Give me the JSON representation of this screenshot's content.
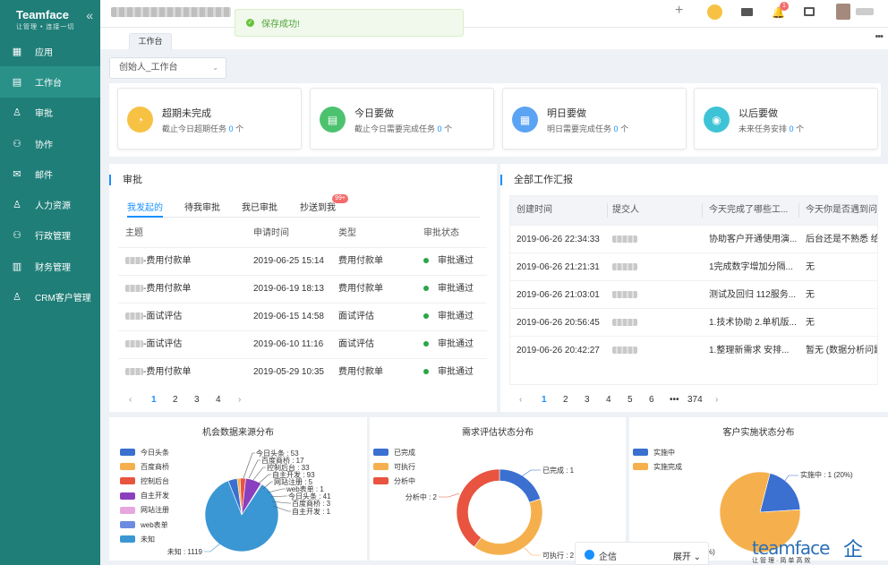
{
  "app": {
    "name": "Teamface",
    "slogan": "让管理 • 连接一切"
  },
  "sidebar": {
    "collapse_icon": "double-chevron-left-icon",
    "items": [
      {
        "label": "应用",
        "icon": "apps-grid-icon",
        "active": false
      },
      {
        "label": "工作台",
        "icon": "dashboard-icon",
        "active": true
      },
      {
        "label": "审批",
        "icon": "person-stamp-icon",
        "active": false
      },
      {
        "label": "协作",
        "icon": "team-icon",
        "active": false
      },
      {
        "label": "邮件",
        "icon": "envelope-icon",
        "active": false
      },
      {
        "label": "人力资源",
        "icon": "person-hr-icon",
        "active": false
      },
      {
        "label": "行政管理",
        "icon": "admin-people-icon",
        "active": false
      },
      {
        "label": "财务管理",
        "icon": "finance-icon",
        "active": false
      },
      {
        "label": "CRM客户管理",
        "icon": "crm-icon",
        "active": false
      }
    ]
  },
  "topbar": {
    "toast": "保存成功!",
    "notification_count": "1"
  },
  "tabs": [
    {
      "label": "工作台"
    }
  ],
  "workbench_selector": "创始人_工作台",
  "task_cards": [
    {
      "title": "超期未完成",
      "subtitle_prefix": "截止今日超期任务",
      "count": "0",
      "suffix": "个",
      "color": "#f7c244",
      "icon": "clock-warning-icon"
    },
    {
      "title": "今日要做",
      "subtitle_prefix": "截止今日需要完成任务",
      "count": "0",
      "suffix": "个",
      "color": "#4cc26f",
      "icon": "calendar-today-icon"
    },
    {
      "title": "明日要做",
      "subtitle_prefix": "明日需要完成任务",
      "count": "0",
      "suffix": "个",
      "color": "#5ba3f3",
      "icon": "calendar-icon"
    },
    {
      "title": "以后要做",
      "subtitle_prefix": "未来任务安排",
      "count": "0",
      "suffix": "个",
      "color": "#3ec3d6",
      "icon": "target-icon"
    }
  ],
  "approval": {
    "title": "审批",
    "tabs": [
      {
        "label": "我发起的",
        "active": true
      },
      {
        "label": "待我审批",
        "active": false
      },
      {
        "label": "我已审批",
        "active": false
      },
      {
        "label": "抄送到我",
        "active": false,
        "badge": "99+"
      }
    ],
    "columns": [
      "主题",
      "申请时间",
      "类型",
      "审批状态"
    ],
    "rows": [
      {
        "subject": "-费用付款单",
        "time": "2019-06-25 15:14",
        "type": "费用付款单",
        "status": "审批通过"
      },
      {
        "subject": "-费用付款单",
        "time": "2019-06-19 18:13",
        "type": "费用付款单",
        "status": "审批通过"
      },
      {
        "subject": "-面试评估",
        "time": "2019-06-15 14:58",
        "type": "面试评估",
        "status": "审批通过"
      },
      {
        "subject": "-面试评估",
        "time": "2019-06-10 11:16",
        "type": "面试评估",
        "status": "审批通过"
      },
      {
        "subject": "-费用付款单",
        "time": "2019-05-29 10:35",
        "type": "费用付款单",
        "status": "审批通过"
      }
    ],
    "pages": [
      "1",
      "2",
      "3",
      "4"
    ],
    "current_page": "1"
  },
  "reports": {
    "title": "全部工作汇报",
    "columns": [
      "创建时间",
      "提交人",
      "今天完成了哪些工...",
      "今天你是否遇到问..."
    ],
    "rows": [
      {
        "time": "2019-06-26 22:34:33",
        "done": "协助客户开通使用演...",
        "issue": "后台还是不熟悉 给..."
      },
      {
        "time": "2019-06-26 21:21:31",
        "done": "1完成数字增加分隔...",
        "issue": "无"
      },
      {
        "time": "2019-06-26 21:03:01",
        "done": "测试及回归 112服务...",
        "issue": "无"
      },
      {
        "time": "2019-06-26 20:56:45",
        "done": "1.技术协助 2.单机版...",
        "issue": "无"
      },
      {
        "time": "2019-06-26 20:42:27",
        "done": "1.整理新需求 安排...",
        "issue": "暂无 (数据分析问题"
      }
    ],
    "pages": [
      "1",
      "2",
      "3",
      "4",
      "5",
      "6",
      "•••",
      "374"
    ],
    "current_page": "1"
  },
  "charts_text": {
    "source_title": "机会数据来源分布",
    "demand_title": "需求评估状态分布",
    "customer_title": "客户实施状态分布"
  },
  "chart_data": [
    {
      "type": "pie",
      "title": "机会数据来源分布",
      "legend_position": "left",
      "series": [
        {
          "name": "今日头条",
          "value": 53,
          "color": "#3b6fd0"
        },
        {
          "name": "百度商桥",
          "value": 17,
          "color": "#f5b04d"
        },
        {
          "name": "控制后台",
          "value": 33,
          "color": "#e8543f"
        },
        {
          "name": "自主开发",
          "value": 93,
          "color": "#8a3fbf"
        },
        {
          "name": "网站注册",
          "value": 5,
          "color": "#e8a6df"
        },
        {
          "name": "web表单",
          "value": 1,
          "color": "#6c8be0"
        },
        {
          "name": "未知",
          "value": 1119,
          "color": "#3a97d4"
        }
      ],
      "labels": [
        "今日头条 : 53",
        "百度商桥 : 17",
        "控制后台 : 33",
        "自主开发 : 93",
        "网站注册 : 5",
        "web表单 : 1",
        "今日头条 : 41",
        "百度商桥 : 3",
        "自主开发 : 1",
        "未知 : 1119"
      ]
    },
    {
      "type": "pie",
      "variant": "donut",
      "title": "需求评估状态分布",
      "legend_position": "left",
      "series": [
        {
          "name": "已完成",
          "value": 1,
          "color": "#3b6fd0"
        },
        {
          "name": "可执行",
          "value": 2,
          "color": "#f5b04d"
        },
        {
          "name": "分析中",
          "value": 2,
          "color": "#e8543f"
        }
      ],
      "labels": [
        "已完成 : 1",
        "可执行 : 2",
        "分析中 : 2"
      ]
    },
    {
      "type": "pie",
      "title": "客户实施状态分布",
      "legend_position": "left",
      "series": [
        {
          "name": "实施中",
          "value": 1,
          "percent": 20,
          "color": "#3b6fd0"
        },
        {
          "name": "实施完成",
          "value": 4,
          "color": "#f5b04d"
        }
      ],
      "labels": [
        "实施中 : 1 (20%)",
        "%)"
      ]
    }
  ],
  "qixin": {
    "label": "企信",
    "expand": "展开"
  },
  "watermark": {
    "en": "teamface",
    "zh": "企典",
    "sub": "让管理·简单高效"
  }
}
